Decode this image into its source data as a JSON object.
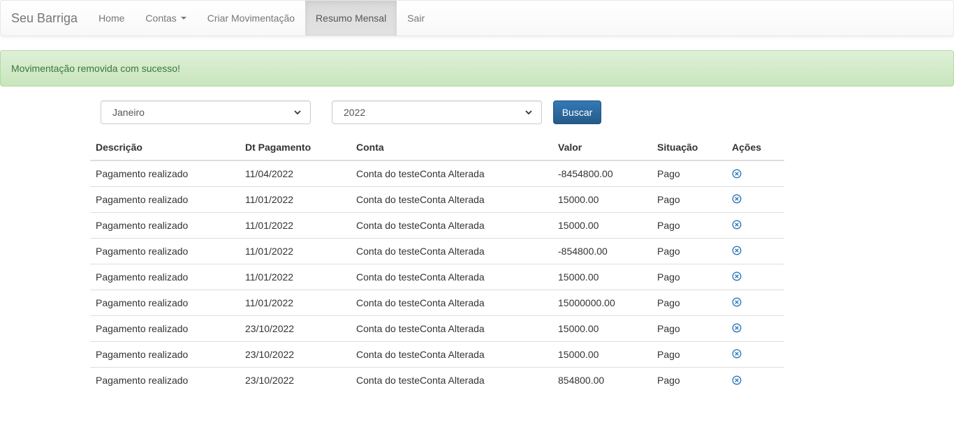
{
  "navbar": {
    "brand": "Seu Barriga",
    "items": [
      {
        "label": "Home"
      },
      {
        "label": "Contas"
      },
      {
        "label": "Criar Movimentação"
      },
      {
        "label": "Resumo Mensal"
      },
      {
        "label": "Sair"
      }
    ],
    "active_item": "Resumo Mensal"
  },
  "alert": {
    "message": "Movimentação removida com sucesso!"
  },
  "filter": {
    "month": "Janeiro",
    "year": "2022",
    "search_label": "Buscar"
  },
  "table": {
    "headers": [
      "Descrição",
      "Dt Pagamento",
      "Conta",
      "Valor",
      "Situação",
      "Ações"
    ],
    "rows": [
      {
        "descricao": "Pagamento realizado",
        "dt": "11/04/2022",
        "conta": "Conta do testeConta Alterada",
        "valor": "-8454800.00",
        "situacao": "Pago"
      },
      {
        "descricao": "Pagamento realizado",
        "dt": "11/01/2022",
        "conta": "Conta do testeConta Alterada",
        "valor": "15000.00",
        "situacao": "Pago"
      },
      {
        "descricao": "Pagamento realizado",
        "dt": "11/01/2022",
        "conta": "Conta do testeConta Alterada",
        "valor": "15000.00",
        "situacao": "Pago"
      },
      {
        "descricao": "Pagamento realizado",
        "dt": "11/01/2022",
        "conta": "Conta do testeConta Alterada",
        "valor": "-854800.00",
        "situacao": "Pago"
      },
      {
        "descricao": "Pagamento realizado",
        "dt": "11/01/2022",
        "conta": "Conta do testeConta Alterada",
        "valor": "15000.00",
        "situacao": "Pago"
      },
      {
        "descricao": "Pagamento realizado",
        "dt": "11/01/2022",
        "conta": "Conta do testeConta Alterada",
        "valor": "15000000.00",
        "situacao": "Pago"
      },
      {
        "descricao": "Pagamento realizado",
        "dt": "23/10/2022",
        "conta": "Conta do testeConta Alterada",
        "valor": "15000.00",
        "situacao": "Pago"
      },
      {
        "descricao": "Pagamento realizado",
        "dt": "23/10/2022",
        "conta": "Conta do testeConta Alterada",
        "valor": "15000.00",
        "situacao": "Pago"
      },
      {
        "descricao": "Pagamento realizado",
        "dt": "23/10/2022",
        "conta": "Conta do testeConta Alterada",
        "valor": "854800.00",
        "situacao": "Pago"
      }
    ]
  },
  "colors": {
    "accent": "#337ab7",
    "success_text": "#3c763d",
    "success_bg": "#dff0d8"
  },
  "icons": {
    "remove": "remove-circle-icon",
    "dropdown": "chevron-down-icon"
  }
}
